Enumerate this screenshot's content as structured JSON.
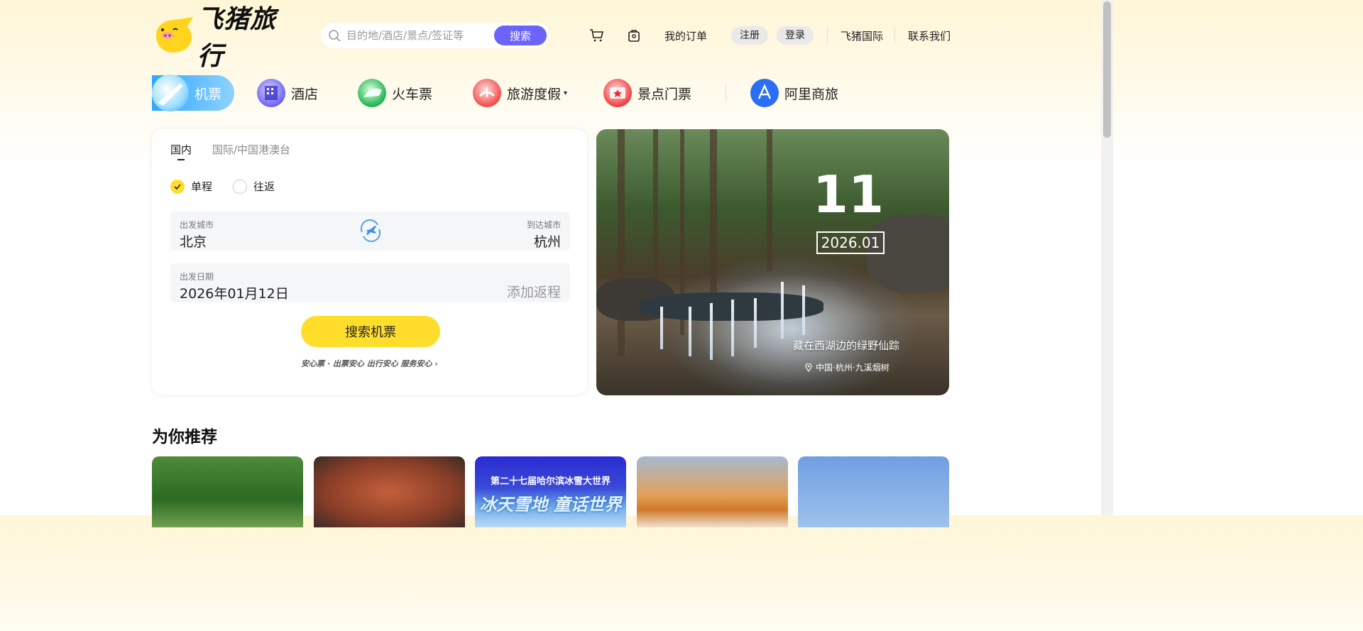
{
  "header": {
    "logo_text": "飞猪旅行",
    "search_placeholder": "目的地/酒店/景点/签证等",
    "search_button": "搜索",
    "my_orders": "我的订单",
    "register": "注册",
    "login": "登录",
    "international": "飞猪国际",
    "contact": "联系我们"
  },
  "nav": {
    "items": [
      {
        "label": "机票",
        "icon": "plane-icon"
      },
      {
        "label": "酒店",
        "icon": "hotel-icon"
      },
      {
        "label": "火车票",
        "icon": "train-icon"
      },
      {
        "label": "旅游度假",
        "icon": "vacation-icon"
      },
      {
        "label": "景点门票",
        "icon": "ticket-icon"
      },
      {
        "label": "阿里商旅",
        "icon": "ali-business-icon"
      }
    ]
  },
  "booking": {
    "tabs": [
      "国内",
      "国际/中国港澳台"
    ],
    "trip_types": [
      "单程",
      "往返"
    ],
    "from_label": "出发城市",
    "from_value": "北京",
    "to_label": "到达城市",
    "to_value": "杭州",
    "date_label": "出发日期",
    "date_value": "2026年01月12日",
    "add_return": "添加返程",
    "search_button": "搜索机票",
    "assurance": "安心票 · 出票安心 出行安心 服务安心 ›"
  },
  "hero": {
    "day": "11",
    "month": "2026.01",
    "caption": "藏在西湖边的绿野仙踪",
    "location": "中国·杭州·九溪烟树"
  },
  "recommend": {
    "title": "为你推荐",
    "poster_line1": "第二十七届哈尔滨冰雪大世界",
    "poster_line2": "冰天雪地 童话世界"
  }
}
